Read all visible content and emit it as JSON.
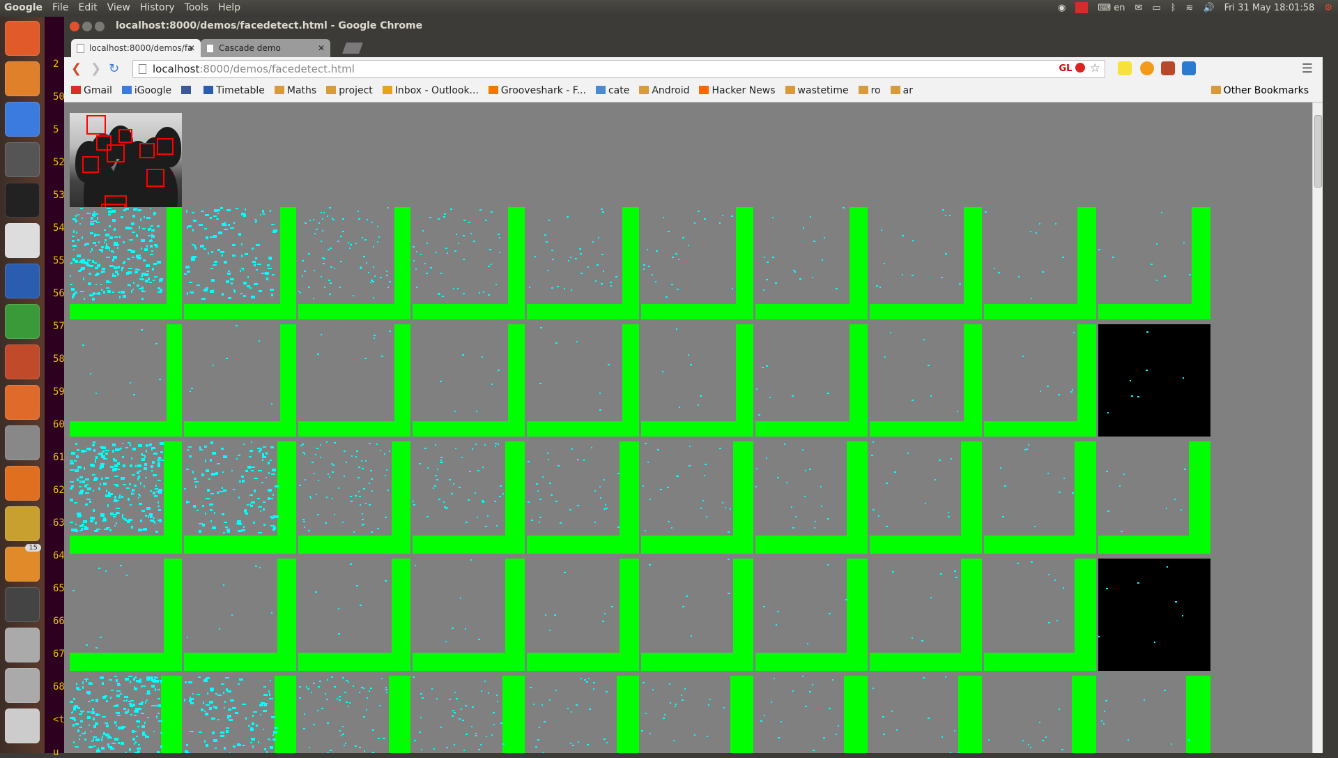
{
  "topbar": {
    "menus": [
      "Google",
      "File",
      "Edit",
      "View",
      "History",
      "Tools",
      "Help"
    ],
    "keyboard": "en",
    "datetime": "Fri 31 May  18:01:58"
  },
  "launcher": {
    "icons": [
      "ubuntu-dash-icon",
      "files-icon",
      "chrome-icon",
      "calculator-icon",
      "terminal-icon",
      "text-editor-icon",
      "writer-icon",
      "calc-spreadsheet-icon",
      "impress-icon",
      "software-center-icon",
      "system-settings-icon",
      "firefox-icon",
      "archive-icon",
      "update-manager-icon",
      "workspace-switcher-icon",
      "drive-icon",
      "drive2-icon",
      "dvd-icon"
    ],
    "update_count": "15"
  },
  "terminal": {
    "lines": [
      "2",
      "50",
      "5",
      "52",
      "53",
      "54",
      "55",
      "56",
      "57",
      "58",
      "59",
      "60",
      "61",
      "62",
      "63",
      "64",
      "65",
      "66",
      "67",
      "68",
      "<t€",
      "u"
    ]
  },
  "window": {
    "title": "localhost:8000/demos/facedetect.html - Google Chrome"
  },
  "tabs": [
    {
      "label": "localhost:8000/demos/fa",
      "active": true
    },
    {
      "label": "Cascade demo",
      "active": false
    }
  ],
  "omnibox": {
    "host": "localhost",
    "path": ":8000/demos/facedetect.html",
    "gl_label": "GL"
  },
  "bookmarks": [
    {
      "label": "Gmail",
      "icon": "gmail-icon",
      "color": "#d93025"
    },
    {
      "label": "iGoogle",
      "icon": "igoogle-icon",
      "color": "#3b7be0"
    },
    {
      "label": "",
      "icon": "facebook-icon",
      "color": "#3b5998"
    },
    {
      "label": "Timetable",
      "icon": "timetable-icon",
      "color": "#2a5db0"
    },
    {
      "label": "Maths",
      "icon": "folder-icon",
      "color": "#d89a3a"
    },
    {
      "label": "project",
      "icon": "folder-icon",
      "color": "#d89a3a"
    },
    {
      "label": "Inbox - Outlook...",
      "icon": "outlook-icon",
      "color": "#e8a020"
    },
    {
      "label": "Grooveshark - F...",
      "icon": "grooveshark-icon",
      "color": "#f07a00"
    },
    {
      "label": "cate",
      "icon": "cate-icon",
      "color": "#4a8ad0"
    },
    {
      "label": "Android",
      "icon": "folder-icon",
      "color": "#d89a3a"
    },
    {
      "label": "Hacker News",
      "icon": "hackernews-icon",
      "color": "#ff6600"
    },
    {
      "label": "wastetime",
      "icon": "folder-icon",
      "color": "#d89a3a"
    },
    {
      "label": "ro",
      "icon": "folder-icon",
      "color": "#d89a3a"
    },
    {
      "label": "ar",
      "icon": "folder-icon",
      "color": "#d89a3a"
    }
  ],
  "other_bookmarks": "Other Bookmarks",
  "canvas": {
    "rows": [
      {
        "type": "A",
        "density": [
          0.55,
          0.28,
          0.17,
          0.11,
          0.07,
          0.05,
          0.035,
          0.025,
          0.02,
          0.015
        ],
        "black_last": false
      },
      {
        "type": "A",
        "density": [
          0.012,
          0.01,
          0.01,
          0.01,
          0.01,
          0.01,
          0.01,
          0.01,
          0.01,
          0.01
        ],
        "black_last": true
      },
      {
        "type": "B",
        "density": [
          0.55,
          0.28,
          0.17,
          0.11,
          0.07,
          0.05,
          0.035,
          0.025,
          0.02,
          0.015
        ],
        "black_last": false
      },
      {
        "type": "B",
        "density": [
          0.012,
          0.01,
          0.01,
          0.01,
          0.01,
          0.01,
          0.01,
          0.01,
          0.01,
          0.01
        ],
        "black_last": true
      },
      {
        "type": "C",
        "density": [
          0.55,
          0.28,
          0.17,
          0.11,
          0.07,
          0.05,
          0.035,
          0.025,
          0.02,
          0.015
        ],
        "black_last": false
      }
    ],
    "colors": {
      "background": "#808080",
      "bar": "#00ff00",
      "feature": "#00ffff",
      "face_box": "#ff0000"
    }
  }
}
